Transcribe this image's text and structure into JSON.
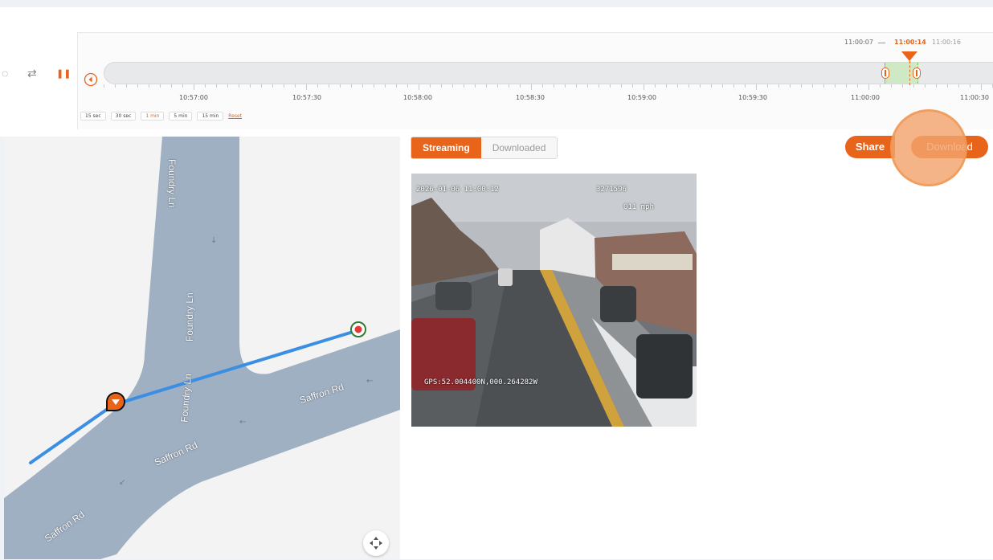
{
  "timeline": {
    "ticks": [
      "10:57:00",
      "10:57:30",
      "10:58:00",
      "10:58:30",
      "10:59:00",
      "10:59:30",
      "11:00:00",
      "11:00:30"
    ],
    "zoom_options": [
      "15 sec",
      "30 sec",
      "1 min",
      "5 min",
      "15 min"
    ],
    "zoom_active": "1 min",
    "reset_label": "Reset",
    "range_start": "11:00:07",
    "playhead_time": "11:00:14",
    "range_end": "11:00:16"
  },
  "tabs": {
    "streaming": "Streaming",
    "downloaded": "Downloaded",
    "active": "Streaming"
  },
  "actions": {
    "share": "Share",
    "download": "Download"
  },
  "video": {
    "timestamp": "2026-01-06 11:00:12",
    "id": "3271596",
    "speed": "011 mph",
    "gps": "GPS:52.004400N,000.264282W"
  },
  "map": {
    "roads": [
      {
        "name": "Foundry Ln"
      },
      {
        "name": "Foundry Ln"
      },
      {
        "name": "Foundry Ln"
      },
      {
        "name": "Saffron Rd"
      },
      {
        "name": "Saffron Rd"
      },
      {
        "name": "Saffron Rd"
      }
    ],
    "route_color": "#3b8fe3",
    "start_marker_color": "#e8641b",
    "end_marker_color": "#2e7d32"
  },
  "colors": {
    "accent": "#e8641b",
    "road": "#9fb0c3",
    "range": "#cfe9c4"
  }
}
